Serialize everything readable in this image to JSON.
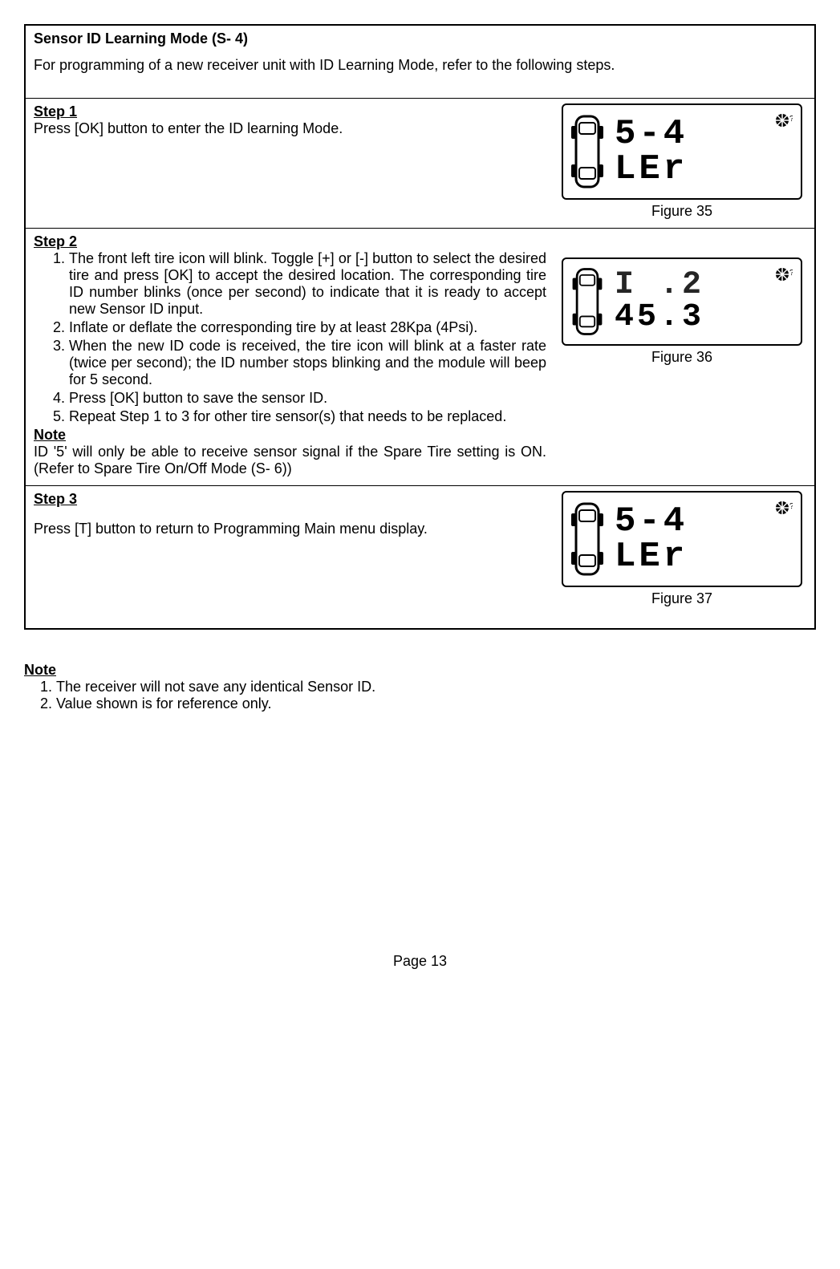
{
  "header": {
    "title": "Sensor ID Learning Mode (S- 4)",
    "intro": "For programming of a new receiver unit with ID Learning Mode, refer to the following steps."
  },
  "step1": {
    "label": "Step 1",
    "text": "Press [OK] button to enter the ID learning Mode.",
    "lcd_line1": "5-4",
    "lcd_line2": "LEr",
    "caption": "Figure 35"
  },
  "step2": {
    "label": "Step 2",
    "items": [
      "The front left tire icon will blink. Toggle [+] or [-] button to select the desired tire and press [OK] to accept the desired location. The corresponding tire ID number blinks (once per second) to indicate that it is ready to accept new Sensor ID input.",
      "Inflate or deflate the corresponding tire by at least 28Kpa (4Psi).",
      "When the new ID code is received, the tire icon will blink at a faster rate (twice per second); the ID number stops blinking and the module will beep for 5 second.",
      "Press [OK] button to save the sensor ID.",
      "Repeat Step 1 to 3 for other tire sensor(s) that needs to be replaced."
    ],
    "note_label": "Note",
    "note_text": "ID '5' will only be able to receive sensor signal if the Spare Tire setting is ON. (Refer to Spare Tire On/Off Mode (S- 6))",
    "lcd_line1": "I .2",
    "lcd_line2": "45.3",
    "caption": "Figure 36"
  },
  "step3": {
    "label": "Step 3",
    "text": "Press [T] button to return to Programming Main menu display.",
    "lcd_line1": "5-4",
    "lcd_line2": "LEr",
    "caption": "Figure 37"
  },
  "bottom_note": {
    "label": "Note",
    "items": [
      "The receiver will not save any identical Sensor ID.",
      "Value shown is for reference only."
    ]
  },
  "page_number": "Page 13"
}
